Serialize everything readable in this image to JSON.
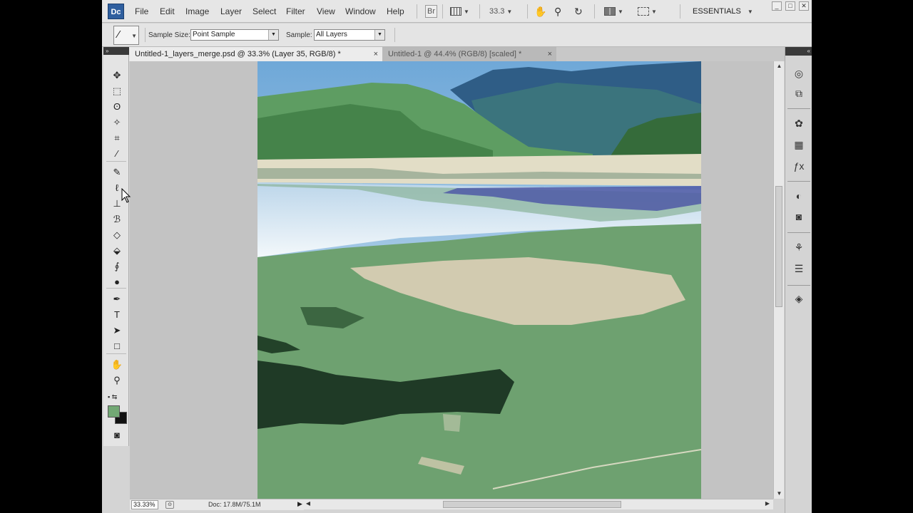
{
  "app": {
    "logo_text": "Dc"
  },
  "menu": {
    "items": [
      "File",
      "Edit",
      "Image",
      "Layer",
      "Select",
      "Filter",
      "View",
      "Window",
      "Help"
    ],
    "bridge_label": "Br",
    "zoom_value": "33.3",
    "workspace": "ESSENTIALS"
  },
  "window_controls": {
    "minimize": "_",
    "restore": "□",
    "close": "✕"
  },
  "options": {
    "sample_size_label": "Sample Size:",
    "sample_size_value": "Point Sample",
    "sample_label": "Sample:",
    "sample_value": "All Layers"
  },
  "tabs": [
    {
      "label": "Untitled-1_layers_merge.psd @ 33.3% (Layer 35, RGB/8) *",
      "active": true
    },
    {
      "label": "Untitled-1 @ 44.4% (RGB/8) [scaled] *",
      "active": false
    }
  ],
  "tab_close": "×",
  "toolbox": {
    "collapse_glyph": "»",
    "tools": [
      {
        "name": "move-tool",
        "glyph": "✥"
      },
      {
        "name": "marquee-tool",
        "glyph": "⬚"
      },
      {
        "name": "lasso-tool",
        "glyph": "ʘ"
      },
      {
        "name": "magic-wand-tool",
        "glyph": "✧"
      },
      {
        "name": "crop-tool",
        "glyph": "⌗"
      },
      {
        "name": "eyedropper-tool",
        "glyph": "⁄"
      },
      {
        "name": "healing-brush-tool",
        "glyph": "✎"
      },
      {
        "name": "brush-tool",
        "glyph": "ℓ"
      },
      {
        "name": "clone-stamp-tool",
        "glyph": "⊥"
      },
      {
        "name": "history-brush-tool",
        "glyph": "ℬ"
      },
      {
        "name": "eraser-tool",
        "glyph": "◇"
      },
      {
        "name": "paint-bucket-tool",
        "glyph": "⬙"
      },
      {
        "name": "dodge-tool",
        "glyph": "∮"
      },
      {
        "name": "burn-tool",
        "glyph": "●"
      },
      {
        "name": "pen-tool",
        "glyph": "✒"
      },
      {
        "name": "type-tool",
        "glyph": "T"
      },
      {
        "name": "path-selection-tool",
        "glyph": "➤"
      },
      {
        "name": "shape-tool",
        "glyph": "□"
      },
      {
        "name": "hand-tool",
        "glyph": "✋"
      },
      {
        "name": "zoom-tool",
        "glyph": "⚲"
      }
    ],
    "foreground_color": "#72a874",
    "background_color": "#111111",
    "quick_mask_glyph": "◙"
  },
  "status": {
    "zoom": "33.33%",
    "doc_info": "Doc: 17.8M/75.1M"
  },
  "dock": {
    "collapse_glyph": "«",
    "buttons": [
      {
        "name": "3d-icon",
        "glyph": "◎"
      },
      {
        "name": "transform-icon",
        "glyph": "⧉"
      },
      {
        "name": "color-icon",
        "glyph": "✿"
      },
      {
        "name": "swatches-icon",
        "glyph": "▦"
      },
      {
        "name": "styles-icon",
        "glyph": "ƒx"
      },
      {
        "name": "adjustments-icon",
        "glyph": "◐"
      },
      {
        "name": "masks-icon",
        "glyph": "◙"
      },
      {
        "name": "clone-source-icon",
        "glyph": "⚘"
      },
      {
        "name": "channels-icon",
        "glyph": "☰"
      },
      {
        "name": "layers-icon",
        "glyph": "◈"
      }
    ]
  }
}
